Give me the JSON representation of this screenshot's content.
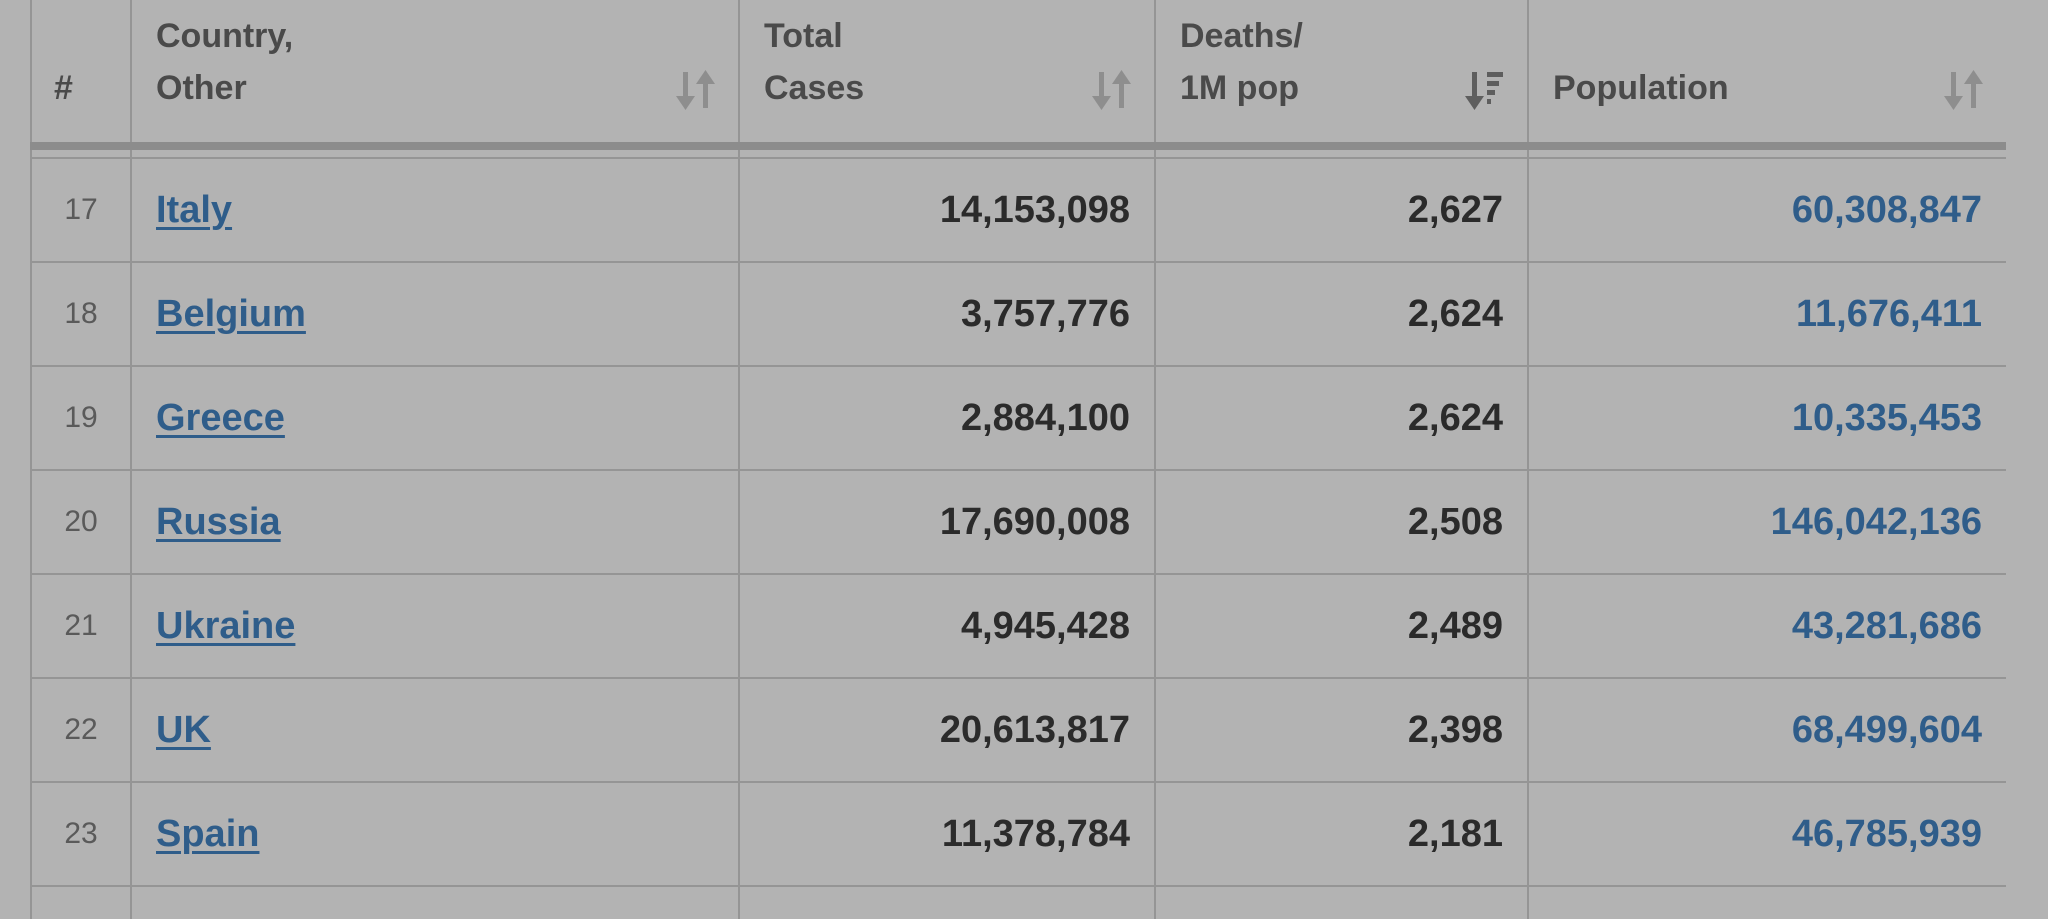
{
  "table": {
    "headers": {
      "num": "#",
      "country_line1": "Country,",
      "country_line2": "Other",
      "cases_line1": "Total",
      "cases_line2": "Cases",
      "deaths_line1": "Deaths/",
      "deaths_line2": "1M pop",
      "population": "Population"
    },
    "sort_state": {
      "country": "unsorted",
      "total_cases": "unsorted",
      "deaths_per_1m": "descending",
      "population": "unsorted"
    },
    "rows": [
      {
        "num": "17",
        "country": "Italy",
        "total_cases": "14,153,098",
        "deaths_per_1m": "2,627",
        "population": "60,308,847"
      },
      {
        "num": "18",
        "country": "Belgium",
        "total_cases": "3,757,776",
        "deaths_per_1m": "2,624",
        "population": "11,676,411"
      },
      {
        "num": "19",
        "country": "Greece",
        "total_cases": "2,884,100",
        "deaths_per_1m": "2,624",
        "population": "10,335,453"
      },
      {
        "num": "20",
        "country": "Russia",
        "total_cases": "17,690,008",
        "deaths_per_1m": "2,508",
        "population": "146,042,136"
      },
      {
        "num": "21",
        "country": "Ukraine",
        "total_cases": "4,945,428",
        "deaths_per_1m": "2,489",
        "population": "43,281,686"
      },
      {
        "num": "22",
        "country": "UK",
        "total_cases": "20,613,817",
        "deaths_per_1m": "2,398",
        "population": "68,499,604"
      },
      {
        "num": "23",
        "country": "Spain",
        "total_cases": "11,378,784",
        "deaths_per_1m": "2,181",
        "population": "46,785,939"
      }
    ]
  },
  "colors": {
    "background": "#b3b3b3",
    "link": "#2f5d8a",
    "header_text": "#4a4a4a",
    "cell_text": "#2b2b2b",
    "grid": "#959595"
  },
  "icons": {
    "sort_unsorted": "sort-unsorted-icon",
    "sort_descending": "sort-descending-icon"
  }
}
